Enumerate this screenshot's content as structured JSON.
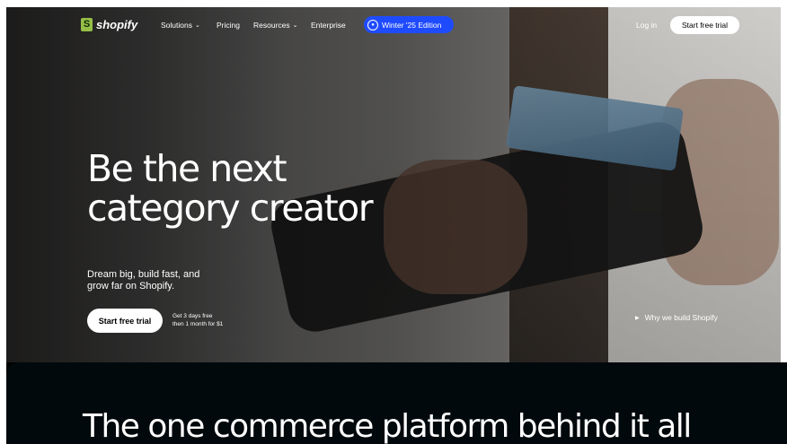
{
  "nav": {
    "logo_text": "shopify",
    "logo_glyph": "S",
    "items": [
      {
        "label": "Solutions",
        "has_dropdown": true
      },
      {
        "label": "Pricing",
        "has_dropdown": false
      },
      {
        "label": "Resources",
        "has_dropdown": true
      },
      {
        "label": "Enterprise",
        "has_dropdown": false
      }
    ],
    "dropdown_icon": "chevron-down-icon",
    "edition_label": "Winter '25 Edition",
    "edition_icon": "edition-badge-icon",
    "login_label": "Log in",
    "start_trial_label": "Start free trial"
  },
  "hero": {
    "headline_line1": "Be the next",
    "headline_line2": "category creator",
    "sub_line1": "Dream big, build fast, and",
    "sub_line2": "grow far on Shopify.",
    "cta_label": "Start free trial",
    "cta_note_line1": "Get 3 days free",
    "cta_note_line2": "then 1 month for $1",
    "why_label": "Why we build Shopify",
    "why_icon": "play-icon"
  },
  "section": {
    "title": "The one commerce platform behind it all"
  },
  "colors": {
    "brand_green": "#95bf47",
    "edition_blue": "#1f4bff",
    "dark_bg": "#02090c"
  }
}
